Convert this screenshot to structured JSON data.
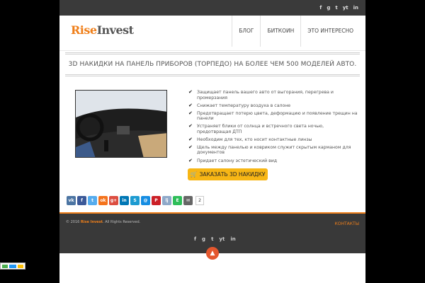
{
  "social": [
    "f",
    "g",
    "t",
    "yt",
    "in"
  ],
  "logo": {
    "part1": "Rise",
    "part2": "Invest"
  },
  "nav": [
    "БЛОГ",
    "БИТКОИН",
    "ЭТО ИНТЕРЕСНО"
  ],
  "headline": "3D НАКИДКИ НА ПАНЕЛЬ ПРИБОРОВ (ТОРПЕДО) НА БОЛЕЕ ЧЕМ 500 МОДЕЛЕЙ АВТО.",
  "features": [
    "Защищает панель вашего авто от выгорания, перегрева и промерзания",
    "Снижает температуру воздуха в салоне",
    "Предотвращает потерю цвета, деформацию и появление трещин на панели",
    "Устраняет блики от солнца и встречного света ночью, предотвращая ДТП",
    "Необходим для тех, кто носит контактные линзы",
    "Щель между панелью и ковриком служит скрытым карманом для документов",
    "Придает салону эстетический вид"
  ],
  "order_button": "ЗАКАЗАТЬ 3D НАКИДКУ",
  "share_count": "2",
  "footer": {
    "year": "© 2016",
    "brand": "Rise Invest",
    "rights": ". All Rights Reserved.",
    "contacts": "КОНТАКТЫ"
  },
  "colors": {
    "accent": "#ef7f1a",
    "button": "#f7b615",
    "dark": "#393939"
  }
}
